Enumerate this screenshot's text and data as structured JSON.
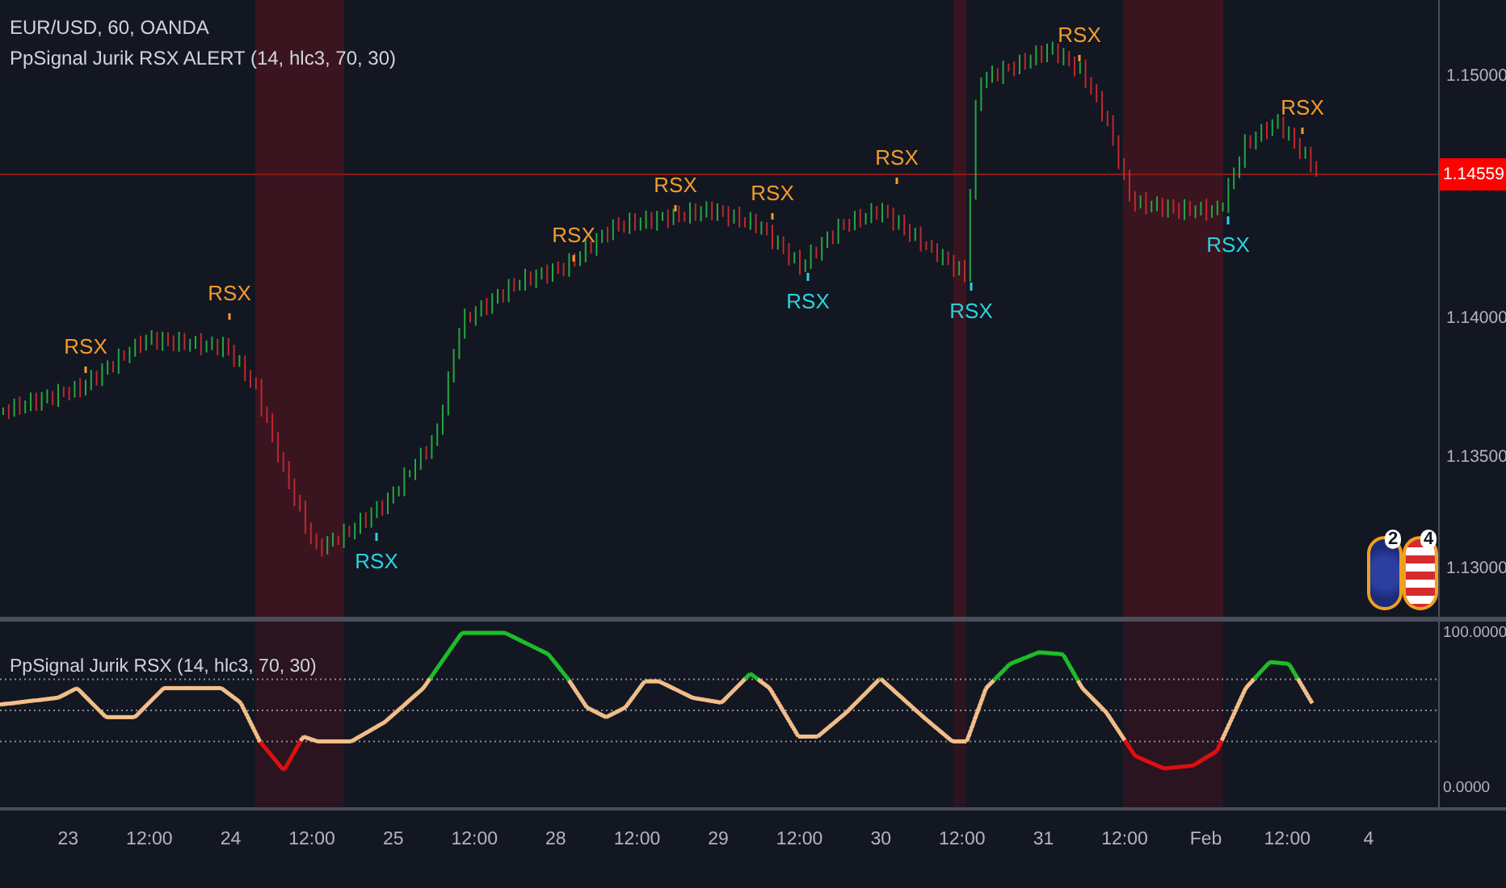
{
  "header": {
    "symbol": "EUR/USD, 60, OANDA",
    "indicator": "PpSignal Jurik RSX ALERT (14, hlc3, 70, 30)"
  },
  "price_axis": {
    "ticks": [
      "1.15000",
      "1.14000",
      "1.13500",
      "1.13000"
    ],
    "last_price": "1.14559"
  },
  "signals": [
    {
      "kind": "sell",
      "label": "RSX"
    },
    {
      "kind": "sell",
      "label": "RSX"
    },
    {
      "kind": "buy",
      "label": "RSX"
    },
    {
      "kind": "sell",
      "label": "RSX"
    },
    {
      "kind": "sell",
      "label": "RSX"
    },
    {
      "kind": "sell",
      "label": "RSX"
    },
    {
      "kind": "buy",
      "label": "RSX"
    },
    {
      "kind": "sell",
      "label": "RSX"
    },
    {
      "kind": "buy",
      "label": "RSX"
    },
    {
      "kind": "sell",
      "label": "RSX"
    },
    {
      "kind": "buy",
      "label": "RSX"
    },
    {
      "kind": "sell",
      "label": "RSX"
    }
  ],
  "events": [
    {
      "kind": "eu",
      "count": "2"
    },
    {
      "kind": "us",
      "count": "4"
    }
  ],
  "oscillator": {
    "title": "PpSignal Jurik RSX (14, hlc3, 70, 30)",
    "ticks": [
      "100.0000",
      "0.0000"
    ]
  },
  "time_axis": {
    "labels": [
      "23",
      "12:00",
      "24",
      "12:00",
      "25",
      "12:00",
      "28",
      "12:00",
      "29",
      "12:00",
      "30",
      "12:00",
      "31",
      "12:00",
      "Feb",
      "12:00",
      "4"
    ]
  }
}
